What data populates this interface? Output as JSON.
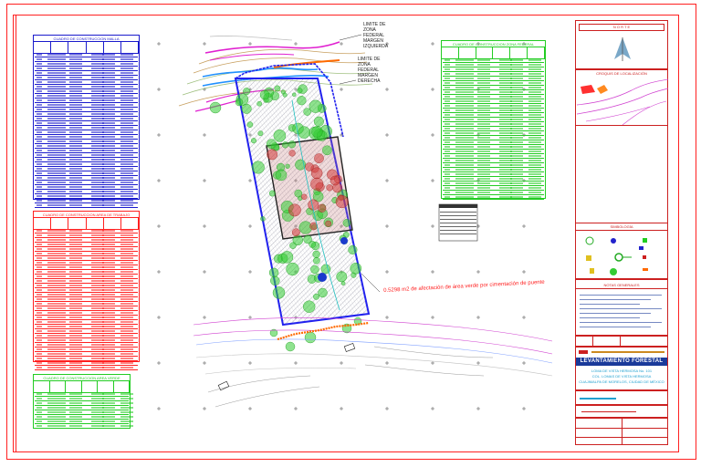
{
  "zone_labels": {
    "left_bank": [
      "LIMITE DE",
      "ZONA",
      "FEDERAL",
      "MARGEN",
      "IZQUIERDA"
    ],
    "right_bank": [
      "LIMITE DE",
      "ZONA",
      "FEDERAL",
      "MARGEN",
      "DERECHA"
    ]
  },
  "annotation": "0.5298 m2 de afectación de área verde por cimentación de puente",
  "tables": [
    {
      "title": "CUADRO DE CONSTRUCCION MALLA",
      "color": "#1a1acc"
    },
    {
      "title": "CUADRO DE CONSTRUCCION AREA DE TRABAJO",
      "color": "#ff2020"
    },
    {
      "title": "CUADRO DE CONSTRUCCION AREA VERDE",
      "color": "#22cc22"
    },
    {
      "title": "CUADRO DE CONSTRUCCION ZONA FEDERAL",
      "color": "#22cc22"
    }
  ],
  "title_block": {
    "north": "N O R T E",
    "location_sketch": "CROQUIS DE LOCALIZACIÓN",
    "legend": "SIMBOLOGÍA",
    "general_notes": "NOTAS GENERALES",
    "drawing_title": "LEVANTAMIENTO FORESTAL",
    "project_lines": [
      "LOMA DE VISTA HERMOSA No. 101",
      "COL. LOMAS DE VISTA HERMOSA",
      "CUAJIMALPA DE MORELOS, CIUDAD DE MÉXICO"
    ]
  },
  "colors": {
    "border": "#ff2020",
    "table_blue": "#1a1acc",
    "table_red": "#ff2020",
    "table_green": "#22cc22",
    "site_outline": "#2222ee",
    "work_area": "#222222",
    "trees": "#33cc33",
    "title_block": "#cc2020",
    "title_bar": "#1a3a9a"
  }
}
